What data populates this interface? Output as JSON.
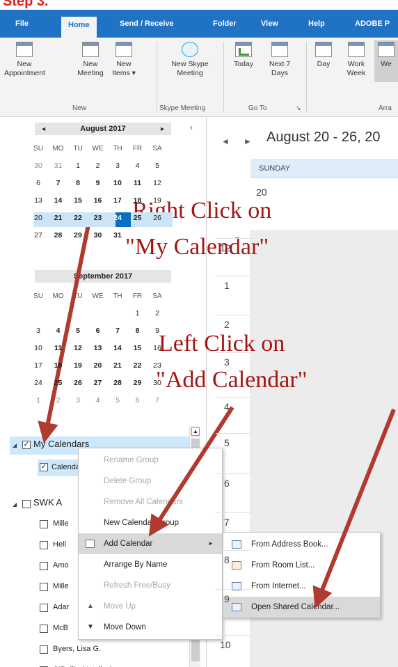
{
  "top_caption": "Step 3.",
  "ribbon": {
    "tabs": [
      "File",
      "Home",
      "Send / Receive",
      "Folder",
      "View",
      "Help",
      "ADOBE P"
    ],
    "active_tab": "Home",
    "buttons": [
      {
        "label": "New Appointment",
        "icon": "calendar-new-icon"
      },
      {
        "label": "New Meeting",
        "icon": "meeting-icon"
      },
      {
        "label": "New Items ▾",
        "icon": "new-items-icon"
      },
      {
        "label": "New Skype Meeting",
        "icon": "skype-icon"
      },
      {
        "label": "Today",
        "icon": "today-icon"
      },
      {
        "label": "Next 7 Days",
        "icon": "next7-icon"
      },
      {
        "label": "Day",
        "icon": "day-view-icon"
      },
      {
        "label": "Work Week",
        "icon": "work-week-icon"
      },
      {
        "label": "We",
        "icon": "week-view-icon"
      }
    ],
    "groups": [
      "New",
      "Skype Meeting",
      "Go To",
      "Arra"
    ]
  },
  "mini_calendars": [
    {
      "title": "August 2017",
      "dow": [
        "SU",
        "MO",
        "TU",
        "WE",
        "TH",
        "FR",
        "SA"
      ],
      "weeks": [
        [
          "30",
          "31",
          "1",
          "2",
          "3",
          "4",
          "5"
        ],
        [
          "6",
          "7",
          "8",
          "9",
          "10",
          "11",
          "12"
        ],
        [
          "13",
          "14",
          "15",
          "16",
          "17",
          "18",
          "19"
        ],
        [
          "20",
          "21",
          "22",
          "23",
          "24",
          "25",
          "26"
        ],
        [
          "27",
          "28",
          "29",
          "30",
          "31",
          "",
          ""
        ]
      ]
    },
    {
      "title": "September 2017",
      "dow": [
        "SU",
        "MO",
        "TU",
        "WE",
        "TH",
        "FR",
        "SA"
      ],
      "weeks": [
        [
          "",
          "",
          "",
          "",
          "",
          "1",
          "2"
        ],
        [
          "3",
          "4",
          "5",
          "6",
          "7",
          "8",
          "9"
        ],
        [
          "10",
          "11",
          "12",
          "13",
          "14",
          "15",
          "16"
        ],
        [
          "17",
          "18",
          "19",
          "20",
          "21",
          "22",
          "23"
        ],
        [
          "24",
          "25",
          "26",
          "27",
          "28",
          "29",
          "30"
        ],
        [
          "1",
          "2",
          "3",
          "4",
          "5",
          "6",
          "7"
        ]
      ]
    }
  ],
  "folders": {
    "group1": "My Calendars",
    "group1_item": "Calendar",
    "group2": "SWK A",
    "group2_items": [
      "Mille",
      "Hell",
      "Amo",
      "Mille",
      "Adar",
      "McB",
      "Byers, Lisa G.",
      "O'Reilly, Natalie A."
    ]
  },
  "main": {
    "range": "August 20 - 26, 20",
    "day_header": "SUNDAY",
    "day_number": "20",
    "hours": [
      "12",
      "1",
      "2",
      "3",
      "4",
      "5",
      "6",
      "7",
      "8",
      "9",
      "10"
    ]
  },
  "context_menu": [
    {
      "label": "Rename Group",
      "disabled": true
    },
    {
      "label": "Delete Group",
      "disabled": true
    },
    {
      "label": "Remove All Calendars",
      "disabled": true
    },
    {
      "label": "New Calendar Group",
      "disabled": false
    },
    {
      "label": "Add Calendar",
      "disabled": false,
      "submenu": true
    },
    {
      "label": "Arrange By Name",
      "disabled": false
    },
    {
      "label": "Refresh Free/Busy",
      "disabled": true
    },
    {
      "label": "Move Up",
      "disabled": true
    },
    {
      "label": "Move Down",
      "disabled": false
    }
  ],
  "submenu": [
    {
      "label": "From Address Book...",
      "icon": "address-book-icon"
    },
    {
      "label": "From Room List...",
      "icon": "room-list-icon"
    },
    {
      "label": "From Internet...",
      "icon": "internet-icon"
    },
    {
      "label": "Open Shared Calendar...",
      "icon": "shared-calendar-icon"
    }
  ],
  "annotations": {
    "right_click_1": "Right Click on",
    "right_click_2": "\"My Calendar\"",
    "left_click_1": "Left Click on",
    "left_click_2": "\"Add Calendar\""
  },
  "colors": {
    "ribbon_blue": "#2072c4",
    "arrow_red": "#b03a2e",
    "anno_red": "#a31515",
    "selection_blue": "#cde8fb"
  }
}
